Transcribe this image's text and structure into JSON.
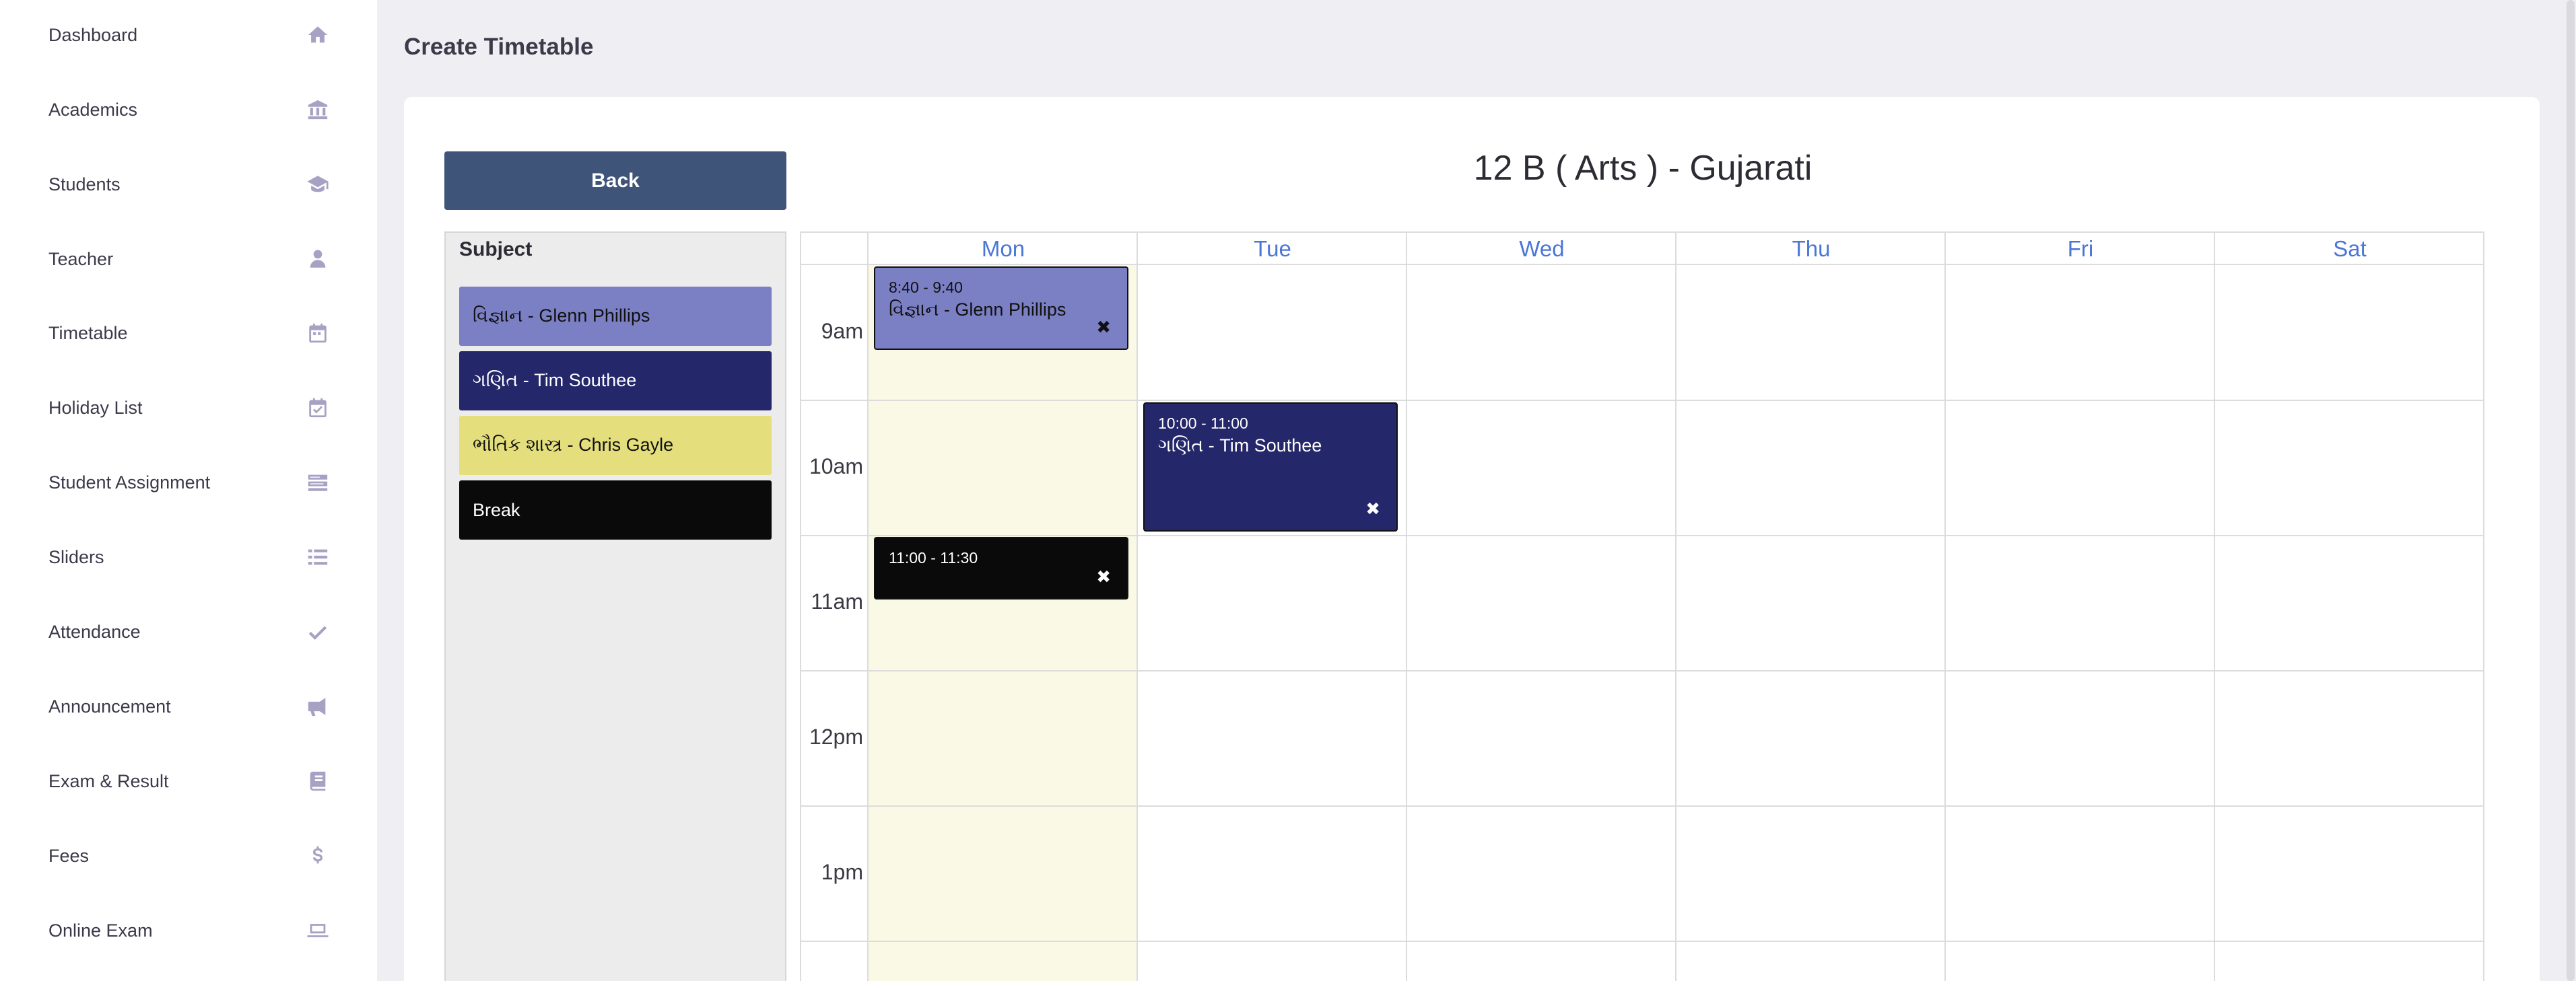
{
  "sidebar": {
    "items": [
      {
        "label": "Dashboard",
        "icon": "home-icon"
      },
      {
        "label": "Academics",
        "icon": "bank-icon"
      },
      {
        "label": "Students",
        "icon": "graduation-cap-icon"
      },
      {
        "label": "Teacher",
        "icon": "user-icon"
      },
      {
        "label": "Timetable",
        "icon": "calendar-icon"
      },
      {
        "label": "Holiday List",
        "icon": "calendar-check-icon"
      },
      {
        "label": "Student Assignment",
        "icon": "tasks-icon"
      },
      {
        "label": "Sliders",
        "icon": "list-icon"
      },
      {
        "label": "Attendance",
        "icon": "check-icon"
      },
      {
        "label": "Announcement",
        "icon": "bullhorn-icon"
      },
      {
        "label": "Exam & Result",
        "icon": "book-icon"
      },
      {
        "label": "Fees",
        "icon": "dollar-icon"
      },
      {
        "label": "Online Exam",
        "icon": "laptop-icon"
      }
    ]
  },
  "page": {
    "title": "Create Timetable",
    "back_label": "Back",
    "heading": "12 B ( Arts ) - Gujarati"
  },
  "subjects": {
    "panel_title": "Subject",
    "items": [
      {
        "label": "વિજ્ઞાન - Glenn Phillips",
        "bg": "#7b7fc4",
        "fg": "#111111"
      },
      {
        "label": "ગણિત - Tim Southee",
        "bg": "#24276a",
        "fg": "#ffffff"
      },
      {
        "label": "ભૌતિક શાસ્ત્ર - Chris Gayle",
        "bg": "#e4df7c",
        "fg": "#111111"
      },
      {
        "label": "Break",
        "bg": "#0a0a0a",
        "fg": "#ffffff"
      }
    ]
  },
  "calendar": {
    "days": [
      "Mon",
      "Tue",
      "Wed",
      "Thu",
      "Fri",
      "Sat"
    ],
    "times": [
      "9am",
      "10am",
      "11am",
      "12pm",
      "1pm"
    ],
    "highlight_day": "Mon",
    "events": [
      {
        "time": "8:40 - 9:40",
        "title": "વિજ્ઞાન - Glenn Phillips",
        "day": "Mon",
        "bg": "#7b7fc4",
        "fg": "#111111",
        "close": "✖"
      },
      {
        "time": "10:00 - 11:00",
        "title": "ગણિત - Tim Southee",
        "day": "Tue",
        "bg": "#24276a",
        "fg": "#ffffff",
        "close": "✖"
      },
      {
        "time": "11:00 - 11:30",
        "title": "",
        "day": "Mon",
        "bg": "#0a0a0a",
        "fg": "#ffffff",
        "close": "✖"
      }
    ]
  },
  "colors": {
    "accent_day": "#4a76d6",
    "back_button": "#3e5479",
    "highlight_column": "#faf9e6"
  }
}
